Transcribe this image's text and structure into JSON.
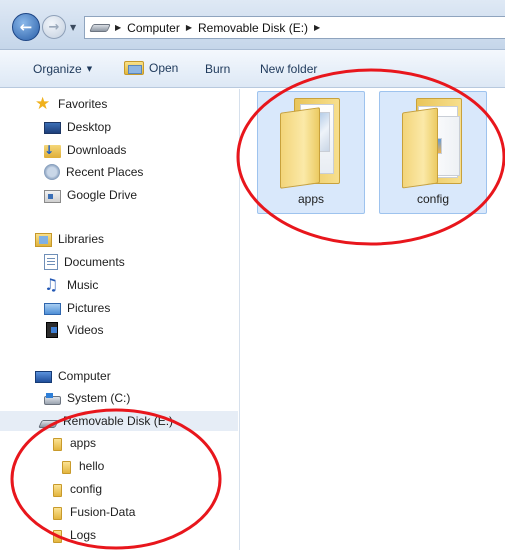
{
  "address_bar": {
    "breadcrumbs": [
      "Computer",
      "Removable Disk (E:)"
    ]
  },
  "toolbar": {
    "organize_label": "Organize",
    "open_label": "Open",
    "burn_label": "Burn",
    "new_folder_label": "New folder"
  },
  "nav": {
    "favorites": {
      "label": "Favorites",
      "items": [
        "Desktop",
        "Downloads",
        "Recent Places",
        "Google Drive"
      ]
    },
    "libraries": {
      "label": "Libraries",
      "items": [
        "Documents",
        "Music",
        "Pictures",
        "Videos"
      ]
    },
    "computer": {
      "label": "Computer",
      "system": "System (C:)",
      "removable": "Removable Disk (E:)",
      "folders": [
        "apps",
        "hello",
        "config",
        "Fusion-Data",
        "Logs"
      ]
    }
  },
  "content": {
    "folders": [
      "apps",
      "config"
    ]
  },
  "colors": {
    "annotation": "#e8161c",
    "selection": "#d9e8fb"
  }
}
